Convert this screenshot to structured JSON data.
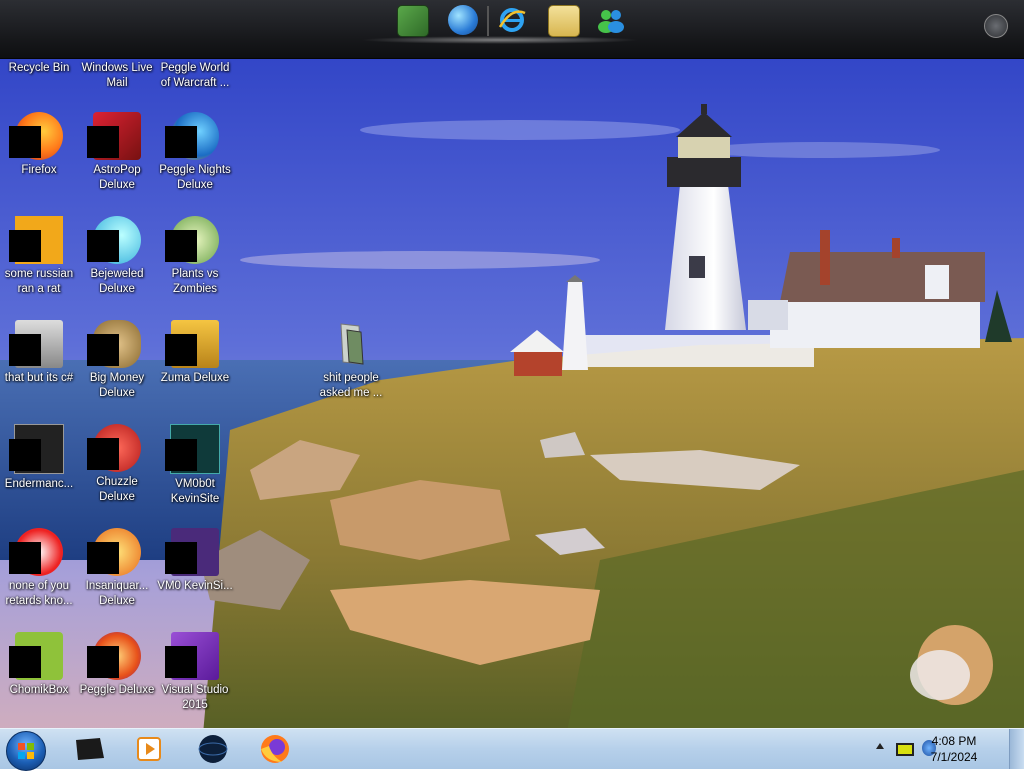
{
  "dock": {
    "icons": [
      "minecraft-icon",
      "globe-download-icon",
      "internet-explorer-icon",
      "mail-icon",
      "messenger-icon"
    ],
    "menu_icon": "dock-menu-icon"
  },
  "desktop": {
    "icons": [
      {
        "label": "Recycle Bin",
        "icon": "recycle-bin-icon"
      },
      {
        "label": "Windows Live Mail",
        "icon": "mail-icon"
      },
      {
        "label": "Peggle World of Warcraft ...",
        "icon": "peggle-icon"
      },
      {
        "label": "Firefox",
        "icon": "firefox-icon"
      },
      {
        "label": "AstroPop Deluxe",
        "icon": "astropop-icon"
      },
      {
        "label": "Peggle Nights Deluxe",
        "icon": "peggle-nights-icon"
      },
      {
        "label": "some russian ran a rat",
        "icon": "app-icon"
      },
      {
        "label": "Bejeweled Deluxe",
        "icon": "bejeweled-icon"
      },
      {
        "label": "Plants vs Zombies",
        "icon": "plants-vs-zombies-icon"
      },
      {
        "label": "that but its c#",
        "icon": "app-icon"
      },
      {
        "label": "Big Money Deluxe",
        "icon": "big-money-icon"
      },
      {
        "label": "Zuma Deluxe",
        "icon": "zuma-icon"
      },
      {
        "label": "shit people asked me ...",
        "icon": "folder-icon"
      },
      {
        "label": "Endermanc...",
        "icon": "terminal-icon"
      },
      {
        "label": "Chuzzle Deluxe",
        "icon": "chuzzle-icon"
      },
      {
        "label": "VM0b0t KevinSite",
        "icon": "terminal-icon"
      },
      {
        "label": "none of you retards kno...",
        "icon": "app-icon"
      },
      {
        "label": "Insaniquar... Deluxe",
        "icon": "insaniquarium-icon"
      },
      {
        "label": "VM0 KevinSi...",
        "icon": "app-icon"
      },
      {
        "label": "ChomikBox",
        "icon": "chomikbox-icon"
      },
      {
        "label": "Peggle Deluxe",
        "icon": "peggle-icon"
      },
      {
        "label": "Visual Studio 2015",
        "icon": "visual-studio-icon"
      }
    ]
  },
  "taskbar": {
    "start_icon": "windows-start-icon",
    "pinned": [
      "task-view-icon",
      "media-player-icon",
      "globe-icon",
      "firefox-icon"
    ],
    "tray": {
      "time": "4:08 PM",
      "date": "7/1/2024",
      "icons": [
        "show-hidden-icons-chevron",
        "battery-icon",
        "network-icon"
      ]
    }
  }
}
